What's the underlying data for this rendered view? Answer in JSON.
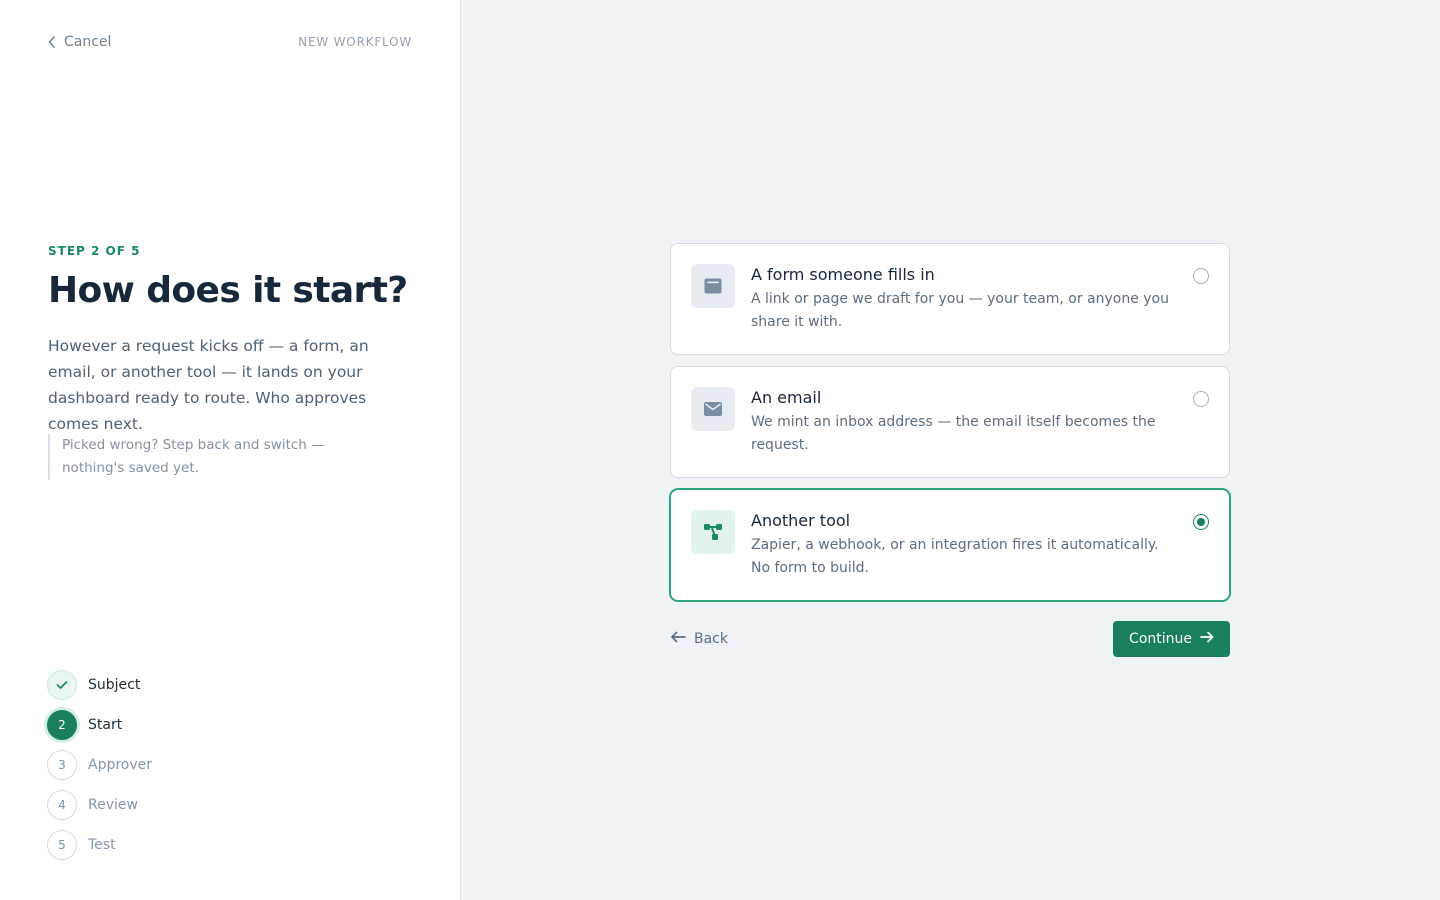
{
  "header": {
    "cancel_label": "Cancel",
    "flow_label": "NEW WORKFLOW"
  },
  "intro": {
    "eyebrow": "STEP 2 OF 5",
    "title": "How does it start?",
    "description": "However a request kicks off — a form, an email, or another tool — it lands on your dashboard ready to route. Who approves comes next.",
    "note": "Picked wrong? Step back and switch — nothing's saved yet."
  },
  "steps": [
    {
      "number": "1",
      "label": "Subject",
      "state": "done"
    },
    {
      "number": "2",
      "label": "Start",
      "state": "active"
    },
    {
      "number": "3",
      "label": "Approver",
      "state": "upcoming"
    },
    {
      "number": "4",
      "label": "Review",
      "state": "upcoming"
    },
    {
      "number": "5",
      "label": "Test",
      "state": "upcoming"
    }
  ],
  "options": [
    {
      "title": "A form someone fills in",
      "description": "A link or page we draft for you — your team, or anyone you share it with.",
      "icon": "form-icon",
      "selected": false
    },
    {
      "title": "An email",
      "description": "We mint an inbox address — the email itself becomes the request.",
      "icon": "mail-icon",
      "selected": false
    },
    {
      "title": "Another tool",
      "description": "Zapier, a webhook, or an integration fires it automatically. No form to build.",
      "icon": "integration-icon",
      "selected": true
    }
  ],
  "actions": {
    "back_label": "Back",
    "continue_label": "Continue"
  },
  "colors": {
    "accent": "#1a7f5f",
    "selected_border": "#2fa57b",
    "background": "#eff3f8"
  }
}
